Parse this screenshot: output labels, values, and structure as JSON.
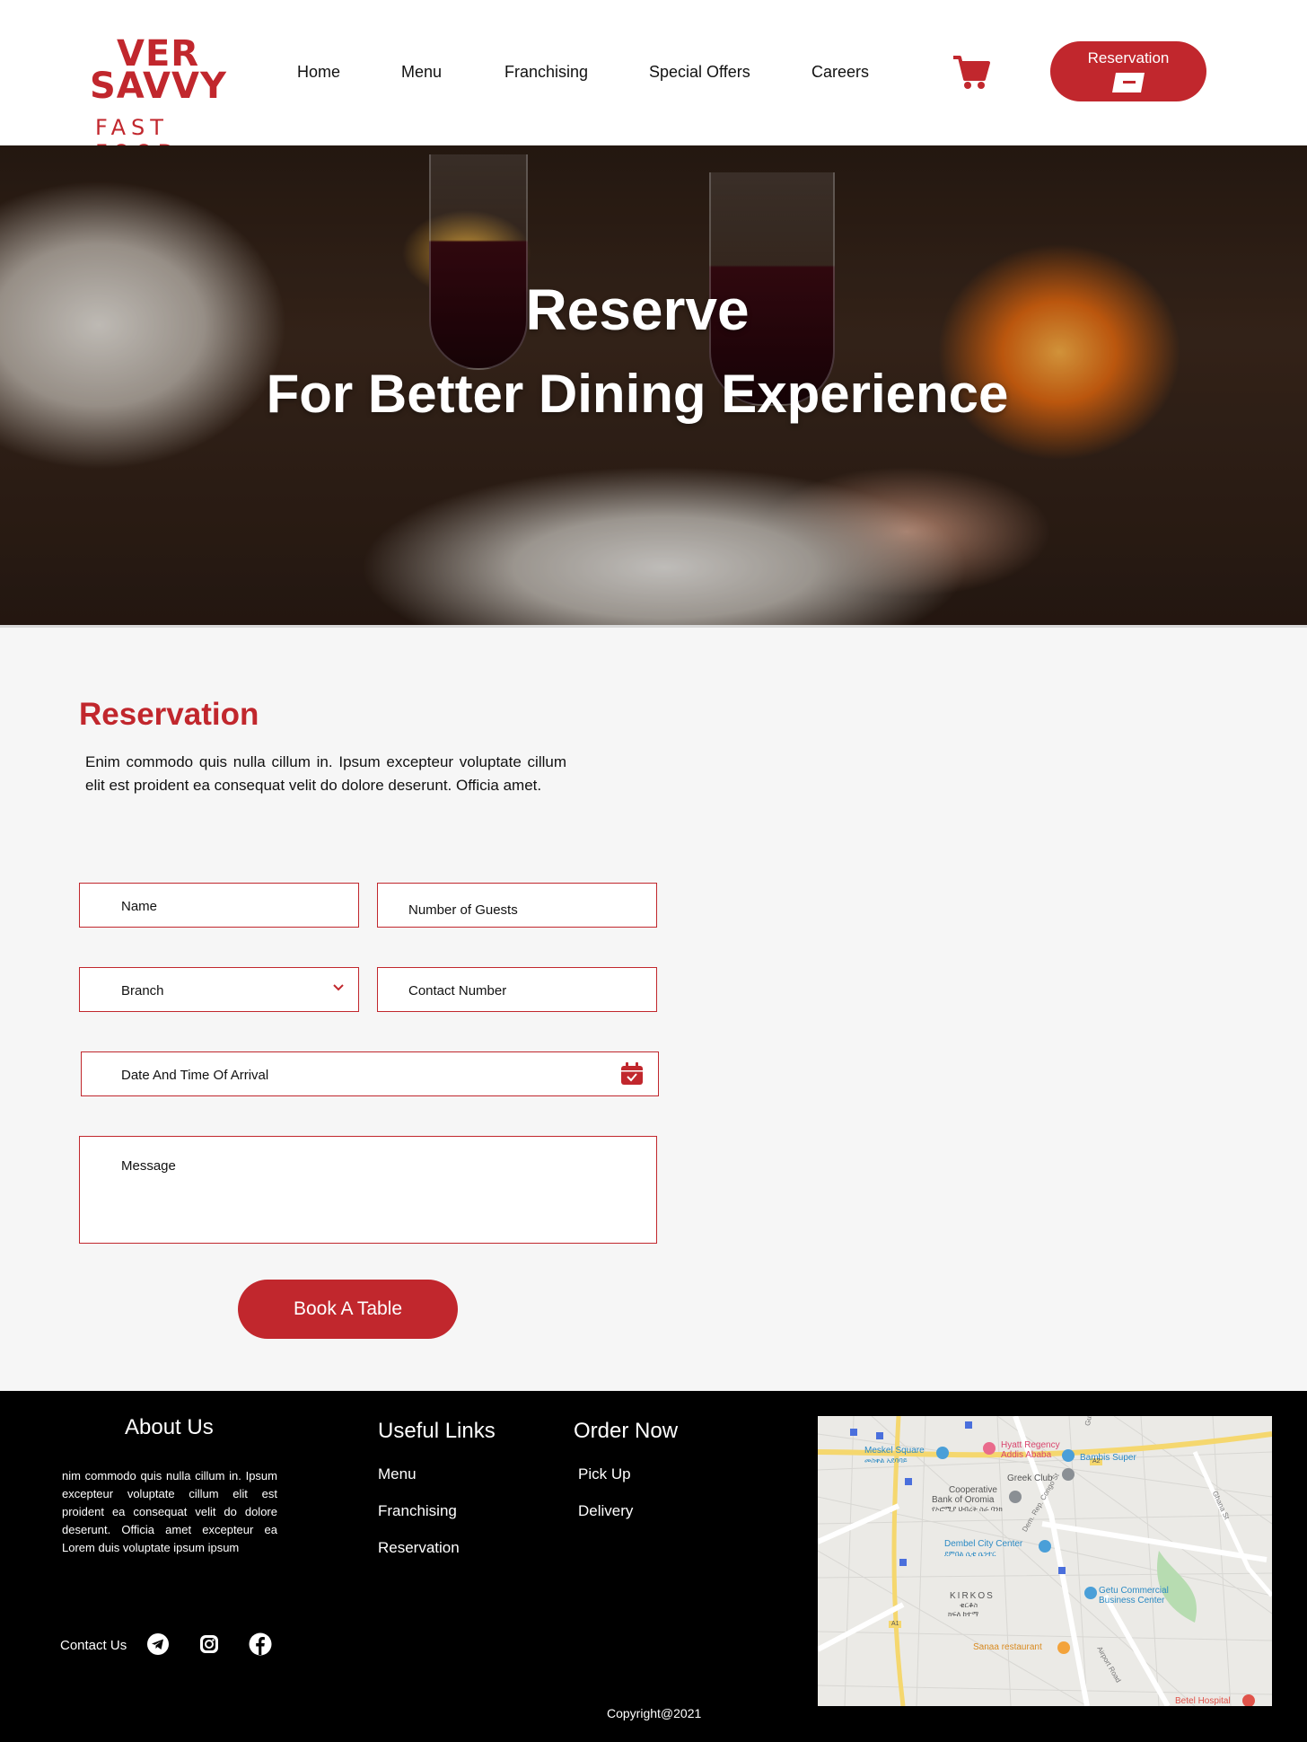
{
  "header": {
    "logo": {
      "line1": "VER",
      "line2": "SAVVY",
      "line3": "FAST FOOD"
    },
    "nav": [
      "Home",
      "Menu",
      "Franchising",
      "Special Offers",
      "Careers"
    ],
    "reservation_button": "Reservation"
  },
  "hero": {
    "title": "Reserve",
    "subtitle": "For Better Dining Experience"
  },
  "reservation": {
    "title": "Reservation",
    "description": "Enim commodo quis nulla cillum in. Ipsum excepteur voluptate cillum elit est proident ea consequat velit do dolore deserunt. Officia amet.",
    "fields": {
      "name": "Name",
      "guests": "Number of Guests",
      "branch": "Branch",
      "contact": "Contact  Number",
      "datetime": "Date And Time Of Arrival",
      "message": "Message"
    },
    "submit": "Book A Table"
  },
  "footer": {
    "about": {
      "title": "About Us",
      "text": "nim commodo quis nulla cillum in. Ipsum excepteur voluptate cillum elit est proident ea consequat velit do dolore deserunt. Officia amet excepteur ea Lorem duis voluptate ipsum ipsum"
    },
    "useful_links": {
      "title": "Useful Links",
      "items": [
        "Menu",
        "Franchising",
        "Reservation"
      ]
    },
    "order_now": {
      "title": "Order Now",
      "items": [
        "Pick Up",
        "Delivery"
      ]
    },
    "contact_label": "Contact Us",
    "map_labels": {
      "meskel": "Meskel Square",
      "meskel_am": "መስቀል አደባባይ",
      "hyatt1": "Hyatt Regency",
      "hyatt2": "Addis Ababa",
      "bambis": "Bambis Super",
      "greek": "Greek Club",
      "coop1": "Cooperative",
      "coop2": "Bank of Oromia",
      "coop_am": "የኦሮሚያ ህብረት ስራ ባንክ",
      "dembel": "Dembel City Center",
      "dembel_am": "ደምበል ሲቲ ሴንተር",
      "getu1": "Getu Commercial",
      "getu2": "Business Center",
      "kirkos": "KIRKOS",
      "kirkos_am1": "ቂርቆስ",
      "kirkos_am2": "ክፍለ ከተማ",
      "sanaa": "Sanaa restaurant",
      "betel": "Betel Hospital",
      "guinea": "Guinea Con",
      "dem_rep": "Dem. Rep. Congo St",
      "ghana": "Ghana St",
      "airport": "Airport Road",
      "a1": "A1",
      "a2": "A2"
    },
    "copyright": "Copyright@2021"
  },
  "colors": {
    "brand_red": "#c1272d",
    "footer_bg": "#000000",
    "section_bg": "#f6f6f6"
  },
  "icons": [
    "cart-icon",
    "reservation-card-icon",
    "chevron-down-icon",
    "calendar-icon",
    "telegram-icon",
    "instagram-icon",
    "facebook-icon"
  ]
}
